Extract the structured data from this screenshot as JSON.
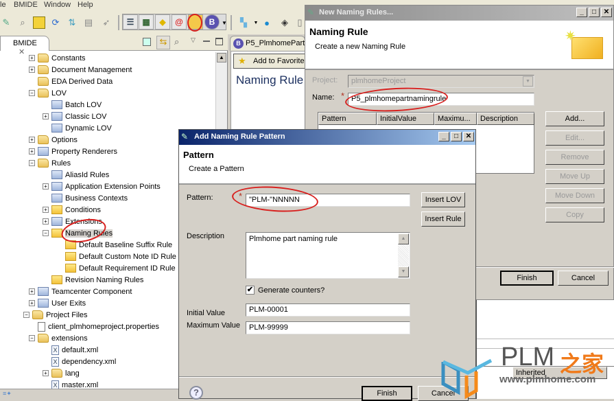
{
  "menu": [
    "le",
    "BMIDE",
    "Window",
    "Help"
  ],
  "toolbar_icons": [
    "new-wizard-icon",
    "search-icon",
    "save-icon",
    "refresh-icon",
    "deploy-icon",
    "console-icon",
    "run-icon",
    "list-icon",
    "checker-icon",
    "condition-icon",
    "alias-icon",
    "naming-rule-icon",
    "business-object-icon",
    "dropdown-icon",
    "hierarchy-icon",
    "sphere-icon",
    "plugin-icon",
    "clipboard-icon"
  ],
  "left_view": {
    "tab_label": "BMIDE",
    "tree": [
      {
        "label": "Constants",
        "indent": 1,
        "expander": "+",
        "icon": "folder"
      },
      {
        "label": "Document Management",
        "indent": 1,
        "expander": "+",
        "icon": "folder"
      },
      {
        "label": "EDA Derived Data",
        "indent": 1,
        "expander": "",
        "icon": "folder"
      },
      {
        "label": "LOV",
        "indent": 1,
        "expander": "-",
        "icon": "folder"
      },
      {
        "label": "Batch LOV",
        "indent": 2,
        "expander": "",
        "icon": "gen"
      },
      {
        "label": "Classic LOV",
        "indent": 2,
        "expander": "+",
        "icon": "gen"
      },
      {
        "label": "Dynamic LOV",
        "indent": 2,
        "expander": "",
        "icon": "gen"
      },
      {
        "label": "Options",
        "indent": 1,
        "expander": "+",
        "icon": "folder"
      },
      {
        "label": "Property Renderers",
        "indent": 1,
        "expander": "+",
        "icon": "gen"
      },
      {
        "label": "Rules",
        "indent": 1,
        "expander": "-",
        "icon": "folder"
      },
      {
        "label": "AliasId Rules",
        "indent": 2,
        "expander": "",
        "icon": "gen"
      },
      {
        "label": "Application Extension Points",
        "indent": 2,
        "expander": "+",
        "icon": "gen"
      },
      {
        "label": "Business Contexts",
        "indent": 2,
        "expander": "",
        "icon": "gen"
      },
      {
        "label": "Conditions",
        "indent": 2,
        "expander": "+",
        "icon": "rulefolder"
      },
      {
        "label": "Extensions",
        "indent": 2,
        "expander": "+",
        "icon": "gen"
      },
      {
        "label": "Naming Rules",
        "indent": 2,
        "expander": "-",
        "icon": "rulefolder",
        "selected": true
      },
      {
        "label": "Default Baseline Suffix Rule",
        "indent": 3,
        "expander": "",
        "icon": "rulefolder"
      },
      {
        "label": "Default Custom Note ID Rule",
        "indent": 3,
        "expander": "",
        "icon": "rulefolder"
      },
      {
        "label": "Default Requirement ID Rule",
        "indent": 3,
        "expander": "",
        "icon": "rulefolder"
      },
      {
        "label": "Revision Naming Rules",
        "indent": 2,
        "expander": "",
        "icon": "rulefolder"
      },
      {
        "label": "Teamcenter Component",
        "indent": 1,
        "expander": "+",
        "icon": "gen"
      },
      {
        "label": "User Exits",
        "indent": 1,
        "expander": "+",
        "icon": "gen"
      },
      {
        "label": "Project Files",
        "indent": 0,
        "expander": "-",
        "icon": "folder"
      },
      {
        "label": "client_plmhomeproject.properties",
        "indent": 1,
        "expander": "",
        "icon": "doc"
      },
      {
        "label": "extensions",
        "indent": 1,
        "expander": "-",
        "icon": "folder"
      },
      {
        "label": "default.xml",
        "indent": 2,
        "expander": "",
        "icon": "xml"
      },
      {
        "label": "dependency.xml",
        "indent": 2,
        "expander": "",
        "icon": "xml"
      },
      {
        "label": "lang",
        "indent": 2,
        "expander": "+",
        "icon": "folder"
      },
      {
        "label": "master.xml",
        "indent": 2,
        "expander": "",
        "icon": "xml"
      }
    ]
  },
  "editor": {
    "tab_label": "P5_PlmhomePart",
    "add_favorites": "Add to Favorite",
    "title": "Naming Rule"
  },
  "new_naming_rules_dialog": {
    "title": "New Naming Rules...",
    "header_title": "Naming Rule",
    "header_subtitle": "Create a new Naming Rule",
    "project_label": "Project:",
    "project_value": "plmhomeProject",
    "name_label": "Name:",
    "name_value": "P5_plmhomepartnamingrule",
    "table_columns": [
      "Pattern",
      "InitialValue",
      "Maximu...",
      "Description"
    ],
    "buttons": {
      "add": "Add...",
      "edit": "Edit...",
      "remove": "Remove",
      "move_up": "Move Up",
      "move_down": "Move Down",
      "copy": "Copy",
      "finish": "Finish",
      "cancel": "Cancel"
    }
  },
  "pattern_dialog": {
    "title": "Add Naming Rule Pattern",
    "header_title": "Pattern",
    "header_subtitle": "Create a Pattern",
    "pattern_label": "Pattern:",
    "pattern_value": "\"PLM-\"NNNNN",
    "insert_lov": "Insert LOV",
    "insert_rule": "Insert Rule",
    "description_label": "Description",
    "description_value": "Plmhome part naming rule",
    "generate_counters_label": "Generate counters?",
    "generate_counters_checked": true,
    "initial_value_label": "Initial Value",
    "initial_value": "PLM-00001",
    "maximum_value_label": "Maximum Value",
    "maximum_value": "PLM-99999",
    "finish": "Finish",
    "cancel": "Cancel"
  },
  "background_table": {
    "column": "Inherited"
  },
  "watermark": {
    "brand": "PLM",
    "brand_cn": "之家",
    "url": "www.plmhome.com"
  },
  "colors": {
    "annotation_red": "#d8201e",
    "active_title": "#0a246a",
    "inactive_title": "#8a8a8a"
  }
}
